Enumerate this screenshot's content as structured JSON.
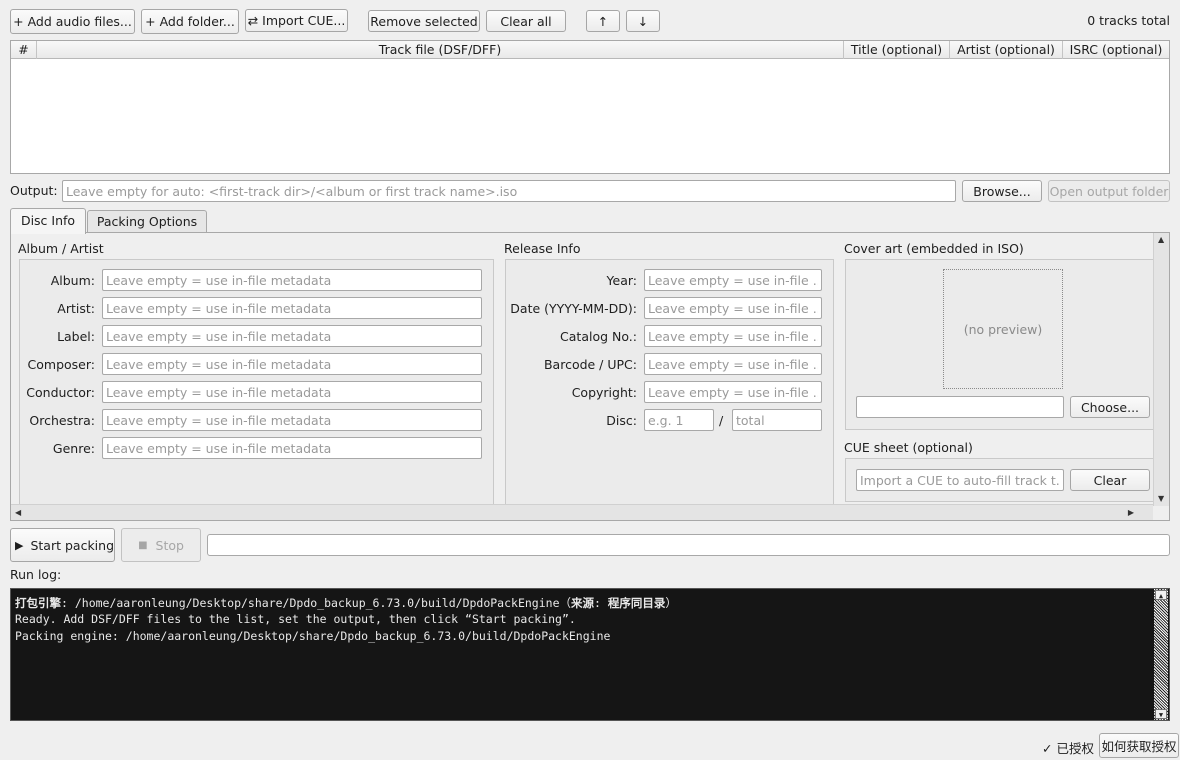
{
  "toolbar": {
    "add_audio_label": "+ Add audio files...",
    "add_folder_label": "+ Add folder...",
    "import_cue_label": "⇄ Import CUE...",
    "remove_selected_label": "Remove selected",
    "clear_all_label": "Clear all",
    "move_up_label": "↑",
    "move_down_label": "↓",
    "tracks_total": "0 tracks total"
  },
  "table": {
    "columns": [
      "#",
      "Track file (DSF/DFF)",
      "Title (optional)",
      "Artist (optional)",
      "ISRC (optional)"
    ]
  },
  "output": {
    "label": "Output:",
    "placeholder": "Leave empty for auto: <first-track dir>/<album or first track name>.iso",
    "browse_label": "Browse...",
    "open_folder_label": "Open output folder"
  },
  "tabs": [
    "Disc Info",
    "Packing Options"
  ],
  "album_artist": {
    "title": "Album / Artist",
    "placeholder": "Leave empty = use in-file metadata",
    "fields": [
      "Album:",
      "Artist:",
      "Label:",
      "Composer:",
      "Conductor:",
      "Orchestra:",
      "Genre:"
    ]
  },
  "release_info": {
    "title": "Release Info",
    "placeholder": "Leave empty = use in-file ...",
    "fields": [
      "Year:",
      "Date (YYYY-MM-DD):",
      "Catalog No.:",
      "Barcode / UPC:",
      "Copyright:"
    ],
    "disc_label": "Disc:",
    "disc_placeholder": "e.g. 1",
    "disc_separator": "/",
    "total_placeholder": "total"
  },
  "cover_art": {
    "title": "Cover art (embedded in ISO)",
    "no_preview": "(no preview)",
    "choose_label": "Choose..."
  },
  "cue_sheet": {
    "title": "CUE sheet (optional)",
    "placeholder": "Import a CUE to auto-fill track t...",
    "clear_label": "Clear"
  },
  "run": {
    "start_label": "Start packing",
    "start_icon": "▶",
    "stop_label": "Stop",
    "stop_icon": "■",
    "progress_value": 0
  },
  "log": {
    "label": "Run log:",
    "engine_prefix": "打包引擎",
    "engine_line": ": /home/aaronleung/Desktop/share/Dpdo_backup_6.73.0/build/DpdoPackEngine（",
    "source_label": "来源",
    "source_sep": ": ",
    "source_value": "程序同目录",
    "source_close": "）",
    "lines": [
      "Ready. Add DSF/DFF files to the list, set the output, then click “Start packing”.",
      "Packing engine: /home/aaronleung/Desktop/share/Dpdo_backup_6.73.0/build/DpdoPackEngine"
    ]
  },
  "license": {
    "status": "✓ 已授权",
    "how_to_label": "如何获取授权"
  }
}
